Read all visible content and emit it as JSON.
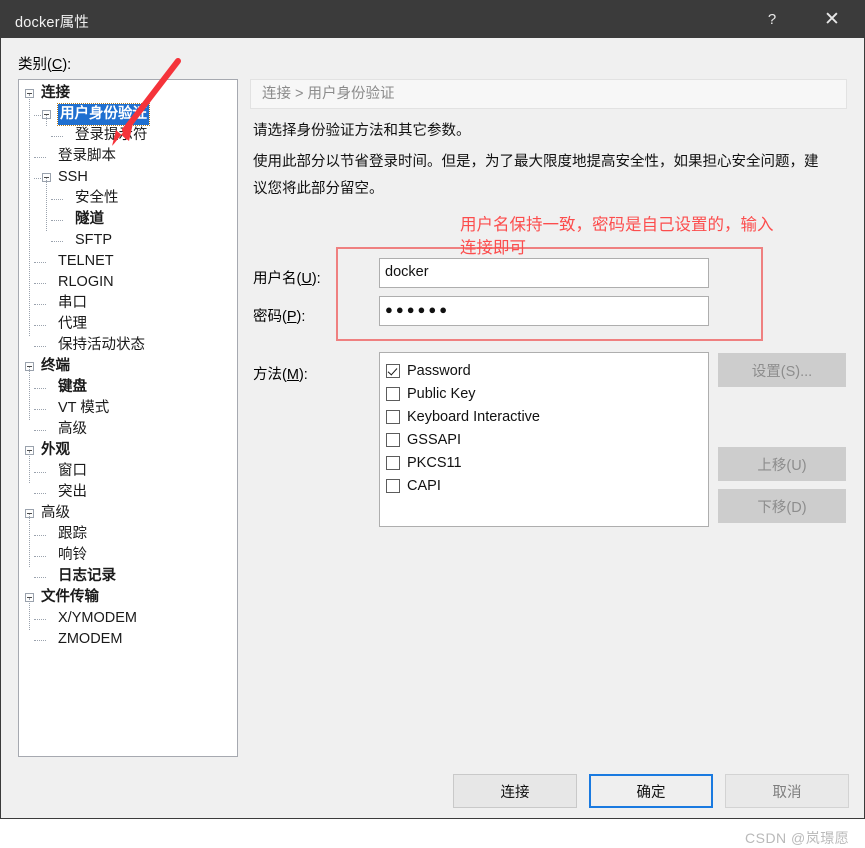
{
  "window": {
    "title": "docker属性",
    "help_icon": "question-mark-icon",
    "close_icon": "close-icon"
  },
  "category": {
    "label_prefix": "类别(",
    "label_key": "C",
    "label_suffix": "):"
  },
  "tree": {
    "items": [
      {
        "label": "连接",
        "depth": 0,
        "bold": true,
        "expander": true,
        "selected": false
      },
      {
        "label": "用户身份验证",
        "depth": 1,
        "bold": true,
        "expander": true,
        "selected": true
      },
      {
        "label": "登录提示符",
        "depth": 2,
        "bold": false,
        "expander": false,
        "selected": false
      },
      {
        "label": "登录脚本",
        "depth": 1,
        "bold": false,
        "expander": false,
        "selected": false
      },
      {
        "label": "SSH",
        "depth": 1,
        "bold": false,
        "expander": true,
        "selected": false
      },
      {
        "label": "安全性",
        "depth": 2,
        "bold": false,
        "expander": false,
        "selected": false
      },
      {
        "label": "隧道",
        "depth": 2,
        "bold": true,
        "expander": false,
        "selected": false
      },
      {
        "label": "SFTP",
        "depth": 2,
        "bold": false,
        "expander": false,
        "selected": false
      },
      {
        "label": "TELNET",
        "depth": 1,
        "bold": false,
        "expander": false,
        "selected": false
      },
      {
        "label": "RLOGIN",
        "depth": 1,
        "bold": false,
        "expander": false,
        "selected": false
      },
      {
        "label": "串口",
        "depth": 1,
        "bold": false,
        "expander": false,
        "selected": false
      },
      {
        "label": "代理",
        "depth": 1,
        "bold": false,
        "expander": false,
        "selected": false
      },
      {
        "label": "保持活动状态",
        "depth": 1,
        "bold": false,
        "expander": false,
        "selected": false
      },
      {
        "label": "终端",
        "depth": 0,
        "bold": true,
        "expander": true,
        "selected": false
      },
      {
        "label": "键盘",
        "depth": 1,
        "bold": true,
        "expander": false,
        "selected": false
      },
      {
        "label": "VT 模式",
        "depth": 1,
        "bold": false,
        "expander": false,
        "selected": false
      },
      {
        "label": "高级",
        "depth": 1,
        "bold": false,
        "expander": false,
        "selected": false
      },
      {
        "label": "外观",
        "depth": 0,
        "bold": true,
        "expander": true,
        "selected": false
      },
      {
        "label": "窗口",
        "depth": 1,
        "bold": false,
        "expander": false,
        "selected": false
      },
      {
        "label": "突出",
        "depth": 1,
        "bold": false,
        "expander": false,
        "selected": false
      },
      {
        "label": "高级",
        "depth": 0,
        "bold": false,
        "expander": true,
        "selected": false
      },
      {
        "label": "跟踪",
        "depth": 1,
        "bold": false,
        "expander": false,
        "selected": false
      },
      {
        "label": "响铃",
        "depth": 1,
        "bold": false,
        "expander": false,
        "selected": false
      },
      {
        "label": "日志记录",
        "depth": 1,
        "bold": true,
        "expander": false,
        "selected": false
      },
      {
        "label": "文件传输",
        "depth": 0,
        "bold": true,
        "expander": true,
        "selected": false
      },
      {
        "label": "X/YMODEM",
        "depth": 1,
        "bold": false,
        "expander": false,
        "selected": false
      },
      {
        "label": "ZMODEM",
        "depth": 1,
        "bold": false,
        "expander": false,
        "selected": false
      }
    ]
  },
  "pane": {
    "breadcrumb": "连接 > 用户身份验证",
    "desc1": "请选择身份验证方法和其它参数。",
    "desc2": "使用此部分以节省登录时间。但是，为了最大限度地提高安全性，如果担心安全问题，建",
    "desc3": "议您将此部分留空。",
    "username_label": "用户名(U):",
    "username_value": "docker",
    "password_label": "密码(P):",
    "password_masked": "●●●●●●",
    "method_label": "方法(M):",
    "methods": [
      {
        "label": "Password",
        "checked": true
      },
      {
        "label": "Public Key",
        "checked": false
      },
      {
        "label": "Keyboard Interactive",
        "checked": false
      },
      {
        "label": "GSSAPI",
        "checked": false
      },
      {
        "label": "PKCS11",
        "checked": false
      },
      {
        "label": "CAPI",
        "checked": false
      }
    ],
    "side_buttons": {
      "settings": "设置(S)...",
      "move_up": "上移(U)",
      "move_down": "下移(D)"
    }
  },
  "footer": {
    "connect": "连接",
    "ok": "确定",
    "cancel": "取消"
  },
  "annotations": {
    "red_line1": "用户名保持一致，密码是自己设置的，输入",
    "red_line2": "连接即可",
    "red_color": "#fc4d4d",
    "box_color": "#ef8080",
    "arrow": "red-arrow-icon"
  },
  "watermark": "CSDN @岚璟愿"
}
